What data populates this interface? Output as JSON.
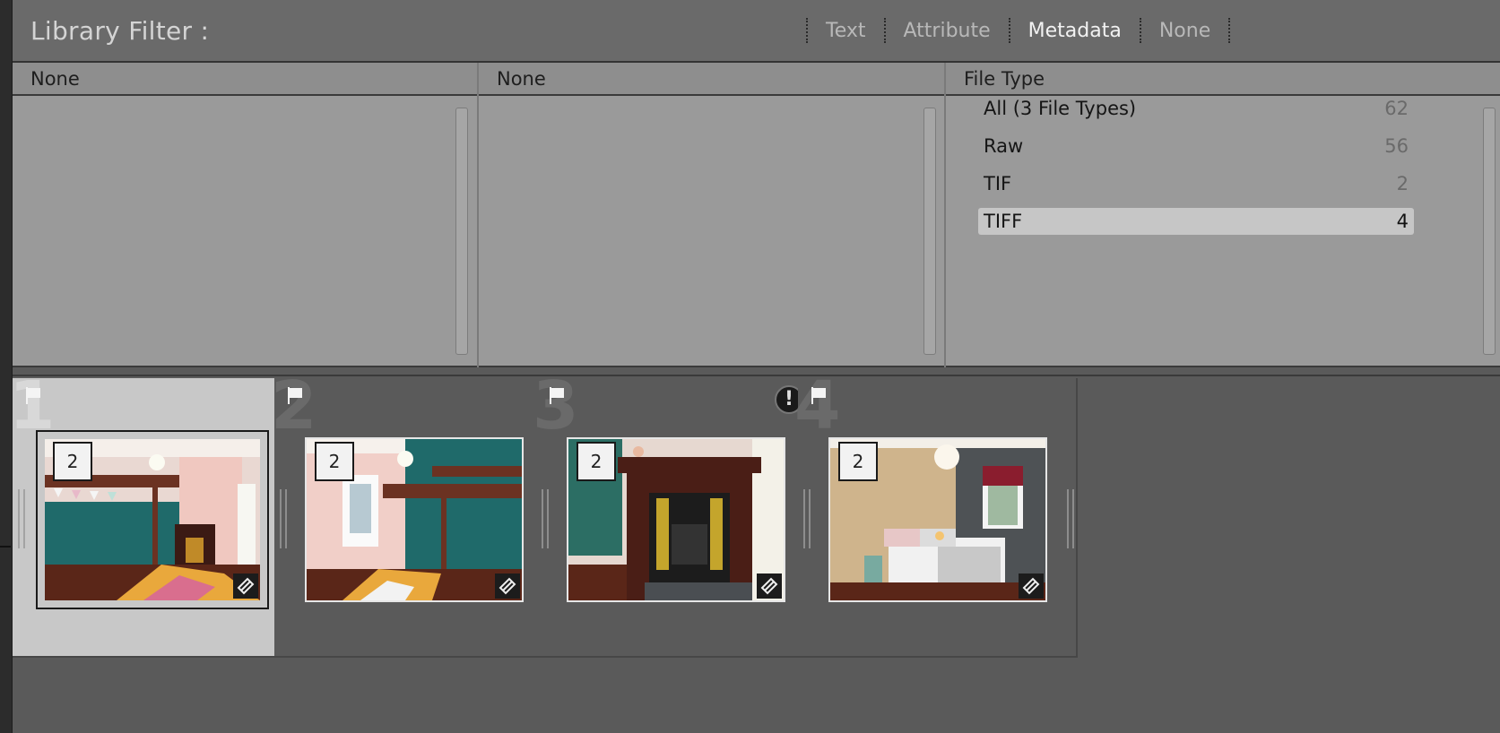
{
  "filter_bar": {
    "title": "Library Filter :",
    "tabs": [
      {
        "label": "Text",
        "active": false
      },
      {
        "label": "Attribute",
        "active": false
      },
      {
        "label": "Metadata",
        "active": true
      },
      {
        "label": "None",
        "active": false
      }
    ]
  },
  "columns": [
    {
      "header": "None",
      "items": []
    },
    {
      "header": "None",
      "items": []
    },
    {
      "header": "File Type",
      "items": [
        {
          "label": "All (3 File Types)",
          "count": "62",
          "selected": false
        },
        {
          "label": "Raw",
          "count": "56",
          "selected": false
        },
        {
          "label": "TIF",
          "count": "2",
          "selected": false
        },
        {
          "label": "TIFF",
          "count": "4",
          "selected": true
        }
      ]
    }
  ],
  "grid": {
    "cells": [
      {
        "number": "1",
        "stack_count": "2",
        "selected": true,
        "warning": false
      },
      {
        "number": "2",
        "stack_count": "2",
        "selected": false,
        "warning": false
      },
      {
        "number": "3",
        "stack_count": "2",
        "selected": false,
        "warning": true
      },
      {
        "number": "4",
        "stack_count": "2",
        "selected": false,
        "warning": false
      }
    ],
    "warning_glyph": "!"
  },
  "colors": {
    "panel_bg": "#9a9a9a",
    "selected_row": "#c6c6c6",
    "grid_bg": "#5a5a5a",
    "selected_cell": "#c8c8c8"
  },
  "icons": [
    "flag-icon",
    "warning-icon",
    "edit-badge-icon",
    "stack-badge"
  ]
}
